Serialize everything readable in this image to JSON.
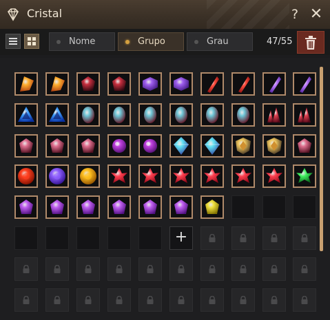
{
  "window": {
    "title": "Cristal",
    "help_label": "?",
    "close_label": "✕"
  },
  "toolbar": {
    "sort_options": [
      {
        "label": "Nome",
        "active": false
      },
      {
        "label": "Grupo",
        "active": true
      },
      {
        "label": "Grau",
        "active": false
      }
    ],
    "count": "47/55"
  },
  "grid": {
    "add_label": "+",
    "rows": [
      [
        "orange-shard",
        "orange-shard",
        "red-gem-dark",
        "red-gem-dark",
        "purple-hex",
        "purple-hex",
        "red-crystal",
        "red-crystal",
        "purple-crystal",
        "purple-crystal"
      ],
      [
        "blue-tri",
        "blue-tri",
        "cyan-egg",
        "cyan-egg",
        "cyan-egg",
        "cyan-egg",
        "cyan-egg",
        "cyan-egg",
        "red-cluster",
        "red-cluster"
      ],
      [
        "pink-stone",
        "pink-stone",
        "pink-stone",
        "violet-orb",
        "violet-orb",
        "cyan-diamond",
        "cyan-diamond",
        "gold-shield",
        "gold-shield",
        "pink-stone"
      ],
      [
        "red-sun",
        "violet-sun",
        "gold-sun",
        "red-star",
        "red-star",
        "red-star",
        "red-star",
        "red-star",
        "red-star",
        "green-star"
      ],
      [
        "purple-gem",
        "purple-gem",
        "purple-gem",
        "purple-gem",
        "purple-gem",
        "purple-gem",
        "yellow-gem",
        "empty",
        "empty",
        "empty"
      ],
      [
        "empty",
        "empty",
        "empty",
        "empty",
        "empty",
        "add",
        "locked",
        "locked",
        "locked",
        "locked"
      ],
      [
        "locked",
        "locked",
        "locked",
        "locked",
        "locked",
        "locked",
        "locked",
        "locked",
        "locked",
        "locked"
      ],
      [
        "locked",
        "locked",
        "locked",
        "locked",
        "locked",
        "locked",
        "locked",
        "locked",
        "locked",
        "locked"
      ]
    ]
  },
  "colors": {
    "orange-shard": [
      "#ffb030",
      "#b04010"
    ],
    "red-gem-dark": [
      "#c83040",
      "#300810"
    ],
    "purple-hex": [
      "#a060f0",
      "#401880"
    ],
    "red-crystal": [
      "#ff5040",
      "#901010"
    ],
    "purple-crystal": [
      "#c080ff",
      "#5020a0"
    ],
    "blue-tri": [
      "#40a0ff",
      "#0830a0"
    ],
    "cyan-egg": [
      "#70c8d8",
      "#601020"
    ],
    "red-cluster": [
      "#e04050",
      "#500818"
    ],
    "pink-stone": [
      "#e07090",
      "#501020"
    ],
    "violet-orb": [
      "#c040e0",
      "#501070"
    ],
    "cyan-diamond": [
      "#60e0f0",
      "#3040a0"
    ],
    "gold-shield": [
      "#f0c860",
      "#403020"
    ],
    "red-sun": [
      "#ff4020",
      "#801000"
    ],
    "violet-sun": [
      "#9060ff",
      "#301090"
    ],
    "gold-sun": [
      "#ffc020",
      "#905000"
    ],
    "red-star": [
      "#ff4050",
      "#900818"
    ],
    "green-star": [
      "#40f060",
      "#086018"
    ],
    "purple-gem": [
      "#c060f0",
      "#501080"
    ],
    "yellow-gem": [
      "#f0e040",
      "#807000"
    ]
  }
}
